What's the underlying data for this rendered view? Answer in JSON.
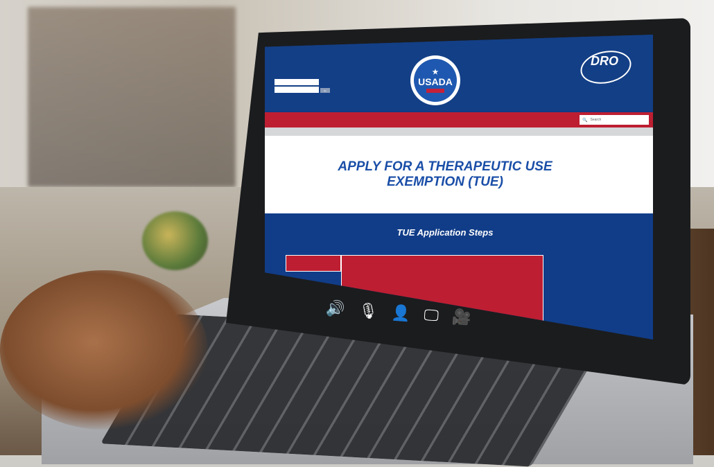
{
  "header": {
    "login": {
      "username_placeholder": "",
      "password_placeholder": "",
      "button_label": "Go"
    },
    "usada_logo": {
      "text": "USADA"
    },
    "dro_logo": {
      "text": "DRO"
    },
    "icons": {
      "logo_star": "★"
    }
  },
  "nav": {
    "items": [
      {
        "label": ""
      },
      {
        "label": ""
      },
      {
        "label": ""
      },
      {
        "label": ""
      },
      {
        "label": ""
      },
      {
        "label": ""
      }
    ],
    "search_placeholder": "Search",
    "search_icon": "🔍"
  },
  "notice": {
    "text": ""
  },
  "hero": {
    "title": "APPLY FOR A THERAPEUTIC USE EXEMPTION (TUE)",
    "subtitle": ""
  },
  "steps": {
    "title": "TUE Application Steps",
    "subtitle": "",
    "list": [
      {
        "label": ""
      },
      {
        "label": ""
      },
      {
        "label": ""
      }
    ],
    "panel": {
      "heading": "",
      "body": ""
    }
  },
  "accessibility_icons": [
    {
      "name": "speaker-icon",
      "glyph": "🔊"
    },
    {
      "name": "microphone-icon",
      "glyph": "🎙"
    },
    {
      "name": "person-icon",
      "glyph": "👤"
    },
    {
      "name": "monitor-icon",
      "glyph": "🖵"
    },
    {
      "name": "video-camera-icon",
      "glyph": "🎥"
    }
  ],
  "colors": {
    "brand_blue": "#133f86",
    "brand_red": "#bd1e32",
    "title_blue": "#1a4ea7"
  }
}
